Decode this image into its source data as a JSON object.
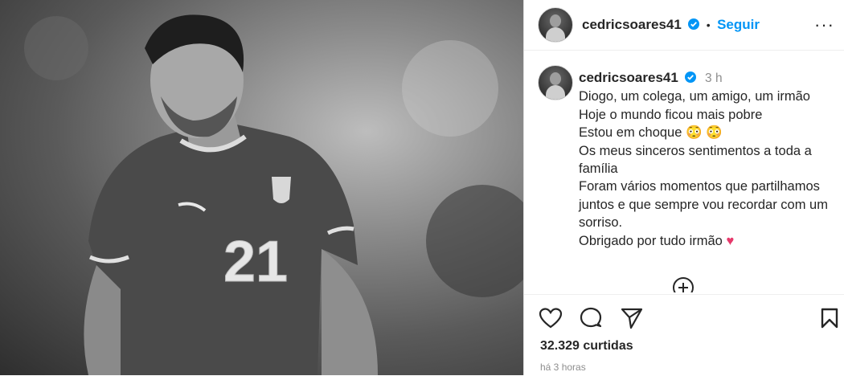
{
  "post": {
    "author": "cedricsoares41",
    "follow_label": "Seguir",
    "dot": "•",
    "more_label": "···",
    "caption_time": "3 h",
    "caption_lines": [
      "Diogo, um colega, um amigo, um irmão",
      "Hoje o mundo ficou mais pobre",
      "Estou em choque",
      "Os meus sinceros sentimentos a toda a família",
      "Foram vários momentos que partilhamos juntos e que sempre vou recordar com um sorriso.",
      "Obrigado por tudo irmão"
    ],
    "emoji_shock": "😳 😳",
    "emoji_heart": "♥",
    "likes": "32.329 curtidas",
    "posted_ago": "há 3 horas"
  },
  "photo": {
    "jersey_number": "21"
  },
  "icons": {
    "like": "heart-icon",
    "comment": "comment-icon",
    "share": "send-icon",
    "save": "bookmark-icon",
    "more": "more-options-icon",
    "load_comments": "plus-circle-icon",
    "verified": "verified-badge-icon"
  },
  "colors": {
    "accent": "#0095f6",
    "text": "#262626",
    "muted": "#8e8e8e",
    "heart": "#e6396b"
  }
}
